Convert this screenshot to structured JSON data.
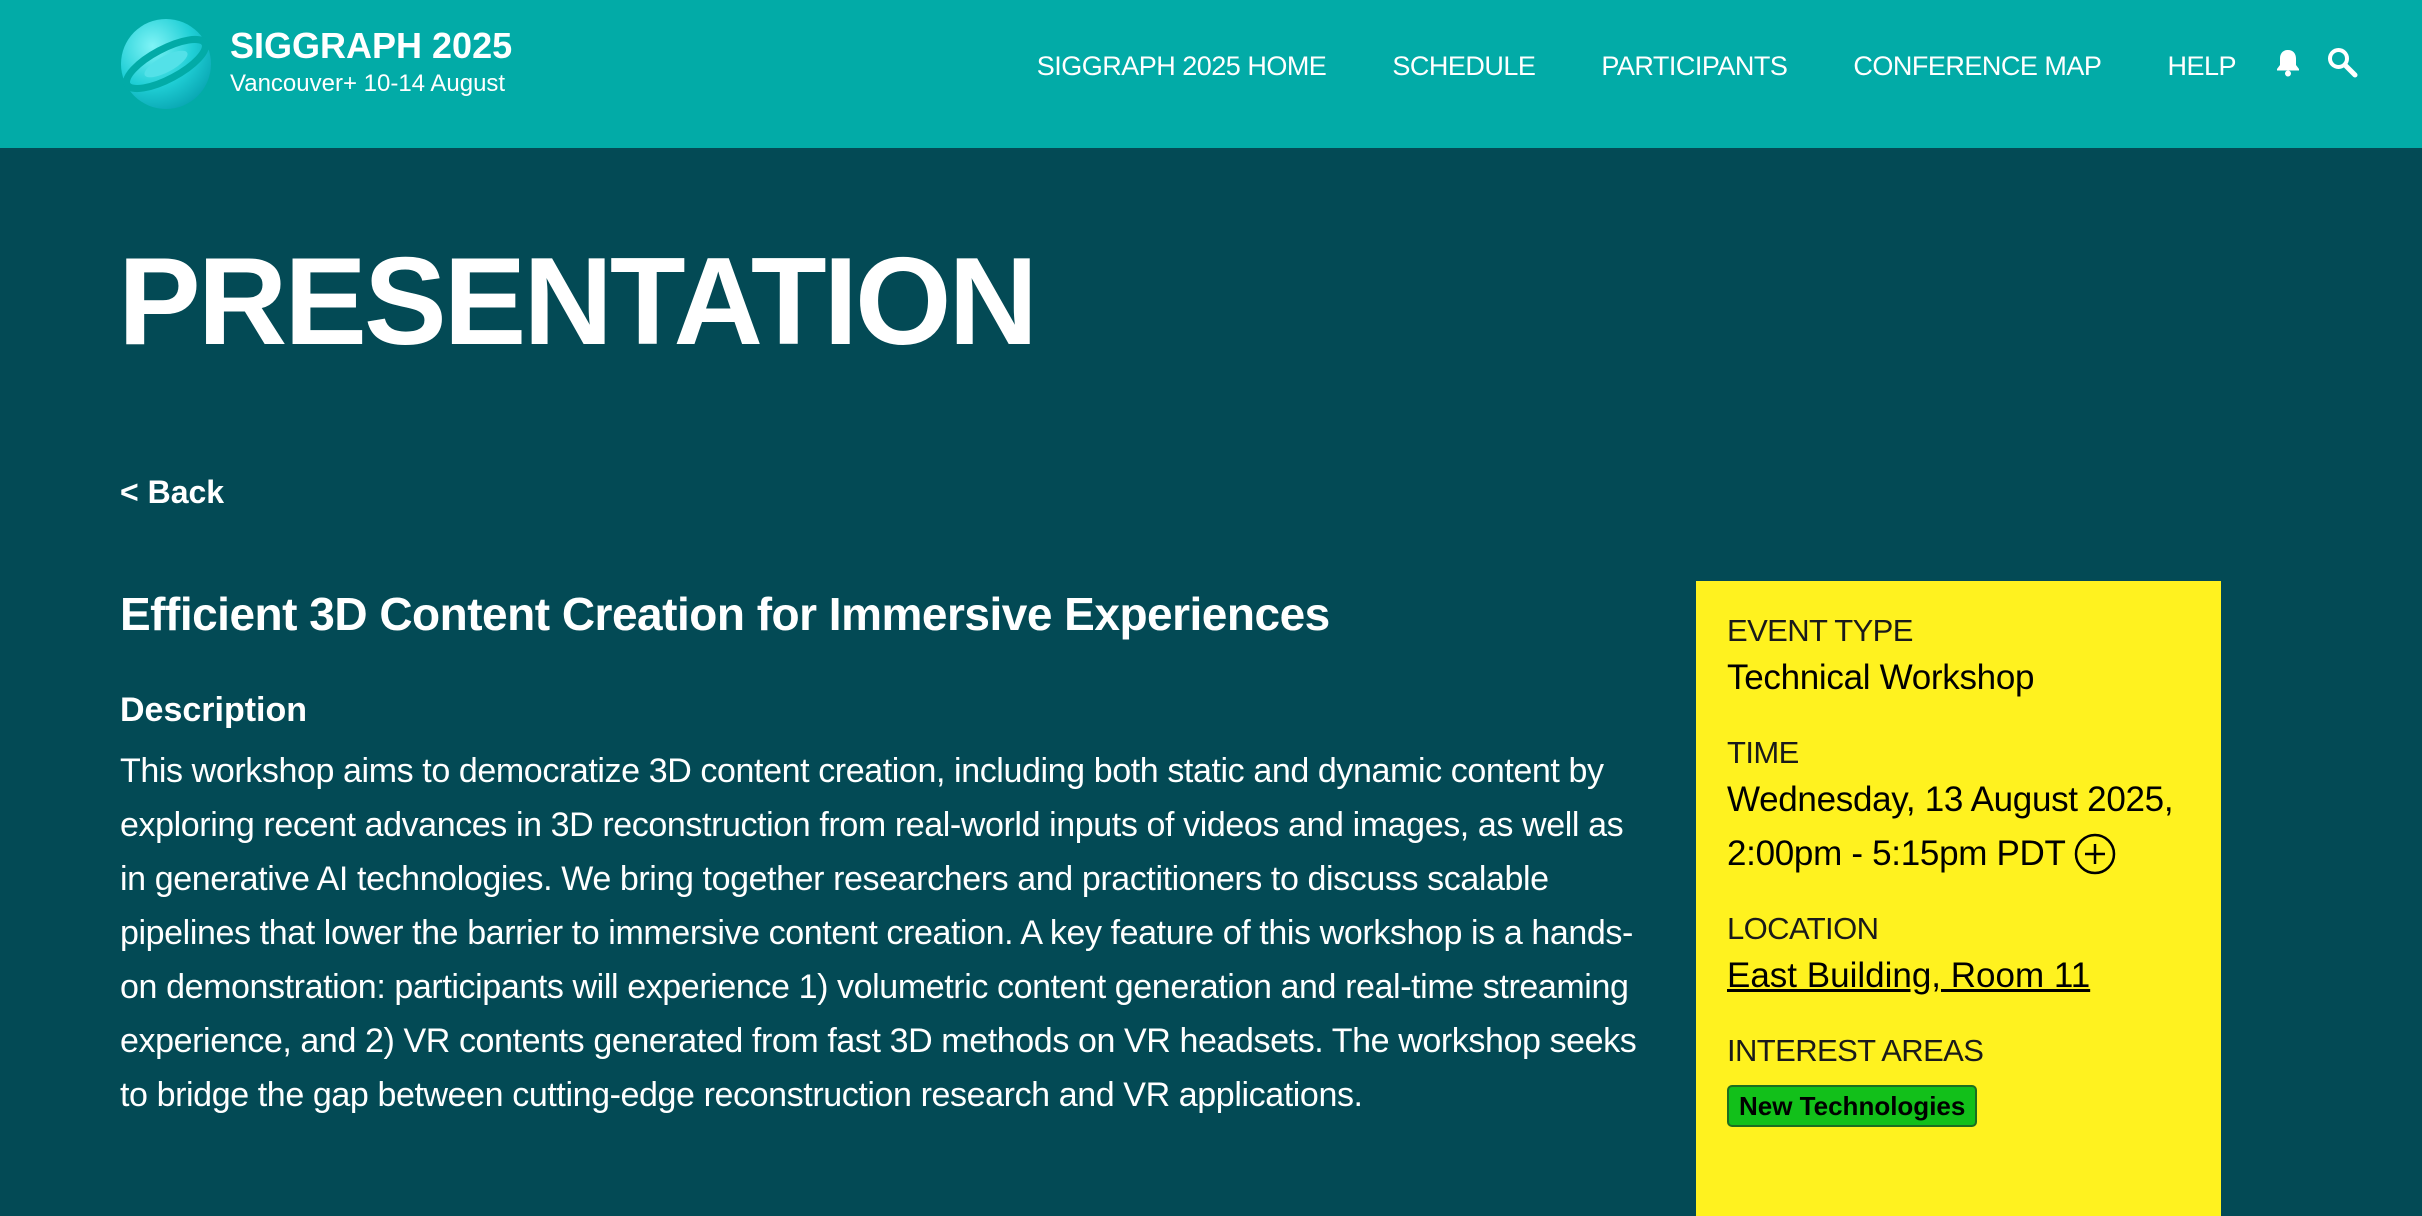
{
  "header": {
    "brand_title": "SIGGRAPH 2025",
    "brand_subtitle": "Vancouver+ 10-14 August",
    "nav": [
      "SIGGRAPH 2025 HOME",
      "SCHEDULE",
      "PARTICIPANTS",
      "CONFERENCE MAP",
      "HELP"
    ],
    "icons": [
      "bell-icon",
      "search-icon"
    ]
  },
  "page": {
    "heading": "PRESENTATION",
    "back_label": "< Back"
  },
  "main": {
    "title": "Efficient 3D Content Creation for Immersive Experiences",
    "description_heading": "Description",
    "description": "This workshop aims to democratize 3D content creation, including both static and dynamic content by exploring recent advances in 3D reconstruction from real-world inputs of videos and images, as well as in generative AI technologies. We bring together researchers and practitioners to discuss scalable pipelines that lower the barrier to immersive content creation. A key feature of this workshop is a hands-on demonstration: participants will experience 1) volumetric content generation and real-time streaming experience, and 2) VR contents generated from fast 3D methods on VR headsets. The workshop seeks to bridge the gap between cutting-edge reconstruction research and VR applications."
  },
  "sidebar": {
    "event_type_label": "EVENT TYPE",
    "event_type": "Technical Workshop",
    "time_label": "TIME",
    "time_line1": "Wednesday, 13 August 2025,",
    "time_line2": "2:00pm - 5:15pm PDT",
    "location_label": "LOCATION",
    "location": "East Building, Room 11",
    "interest_label": "INTEREST AREAS",
    "interest_tags": [
      "New Technologies"
    ]
  },
  "colors": {
    "header_bg": "#02aba7",
    "page_bg": "#034a55",
    "sidebar_bg": "#fff21f",
    "tag_bg": "#12c01a"
  }
}
